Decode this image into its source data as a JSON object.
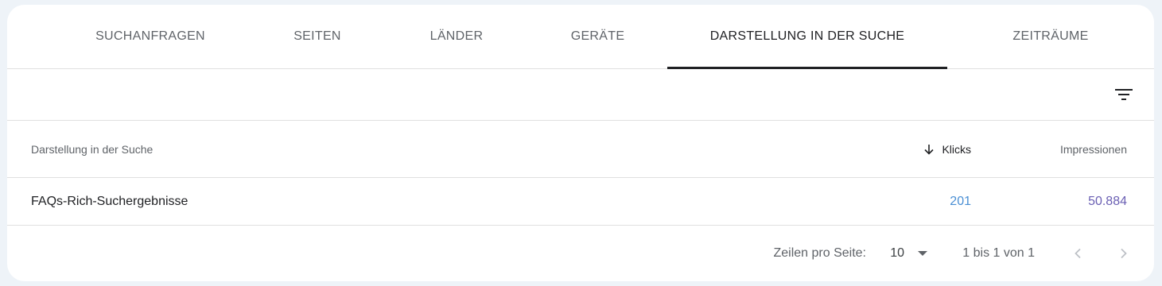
{
  "tabs": [
    {
      "label": "SUCHANFRAGEN",
      "active": false
    },
    {
      "label": "SEITEN",
      "active": false
    },
    {
      "label": "LÄNDER",
      "active": false
    },
    {
      "label": "GERÄTE",
      "active": false
    },
    {
      "label": "DARSTELLUNG IN DER SUCHE",
      "active": true
    },
    {
      "label": "ZEITRÄUME",
      "active": false
    }
  ],
  "toolbar": {
    "filter_icon": "filter-list-icon"
  },
  "table": {
    "columns": {
      "label": "Darstellung in der Suche",
      "clicks": "Klicks",
      "impressions": "Impressionen"
    },
    "sort": {
      "column": "clicks",
      "direction": "descending",
      "icon": "arrow-down-icon"
    },
    "rows": [
      {
        "label": "FAQs-Rich-Suchergebnisse",
        "clicks": "201",
        "impressions": "50.884"
      }
    ]
  },
  "pagination": {
    "rows_per_page_label": "Zeilen pro Seite:",
    "rows_per_page_value": "10",
    "range_text": "1 bis 1 von 1",
    "prev_icon": "chevron-left-icon",
    "next_icon": "chevron-right-icon"
  },
  "colors": {
    "clicks": "#4a8fd4",
    "impressions": "#6a5fb3",
    "active_tab_indicator": "#202124"
  }
}
